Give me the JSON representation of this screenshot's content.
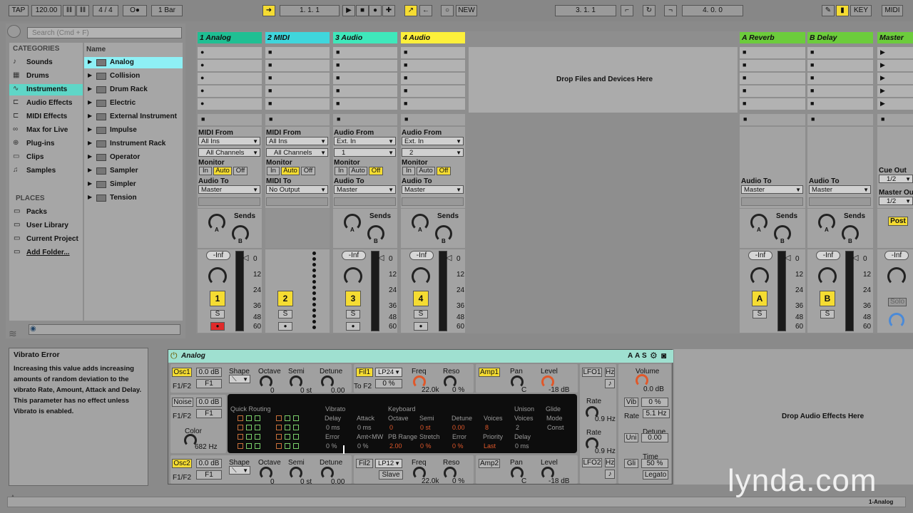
{
  "transport": {
    "tap": "TAP",
    "tempo": "120.00",
    "signature": "4 / 4",
    "metronome": "O●",
    "quantize": "1 Bar",
    "position": "1.  1.  1",
    "new": "NEW",
    "loop_start": "3.  1.  1",
    "loop_length": "4.  0.  0",
    "key": "KEY",
    "midi": "MIDI"
  },
  "colors": {
    "accent": "#f5dc32",
    "selected_category": "#5fd6c7",
    "selected_item": "#8ef0f5",
    "device_title": "#9fe0d0",
    "orange": "#e0582a"
  },
  "browser": {
    "search_placeholder": "Search (Cmd + F)",
    "categories_heading": "CATEGORIES",
    "categories": [
      "Sounds",
      "Drums",
      "Instruments",
      "Audio Effects",
      "MIDI Effects",
      "Max for Live",
      "Plug-ins",
      "Clips",
      "Samples"
    ],
    "selected_category": "Instruments",
    "places_heading": "PLACES",
    "places": [
      "Packs",
      "User Library",
      "Current Project",
      "Add Folder..."
    ],
    "name_header": "Name",
    "items": [
      "Analog",
      "Collision",
      "Drum Rack",
      "Electric",
      "External Instrument",
      "Impulse",
      "Instrument Rack",
      "Operator",
      "Sampler",
      "Simpler",
      "Tension"
    ],
    "selected_item": "Analog"
  },
  "session": {
    "drop_text": "Drop Files and Devices Here",
    "sends_label": "Sends",
    "send_a": "A",
    "send_b": "B",
    "meter_scale": [
      "0",
      "12",
      "24",
      "36",
      "48",
      "60"
    ],
    "tracks": [
      {
        "name": "1 Analog",
        "color": "#1fbf93",
        "from_label": "MIDI From",
        "from": "All Ins",
        "channel": "All Channels",
        "monitor_label": "Monitor",
        "monitor": [
          "In",
          "Auto",
          "Off"
        ],
        "monitor_active": 1,
        "to_label": "Audio To",
        "to": "Master",
        "volume": "-Inf",
        "number": "1",
        "solo": "S"
      },
      {
        "name": "2 MIDI",
        "color": "#3fd6dc",
        "from_label": "MIDI From",
        "from": "All Ins",
        "channel": "All Channels",
        "monitor_label": "Monitor",
        "monitor": [
          "In",
          "Auto",
          "Off"
        ],
        "monitor_active": 1,
        "to_label": "MIDI To",
        "to": "No Output",
        "number": "2",
        "solo": "S"
      },
      {
        "name": "3 Audio",
        "color": "#3fe8bb",
        "from_label": "Audio From",
        "from": "Ext. In",
        "channel": "1",
        "monitor_label": "Monitor",
        "monitor": [
          "In",
          "Auto",
          "Off"
        ],
        "monitor_active": 2,
        "to_label": "Audio To",
        "to": "Master",
        "volume": "-Inf",
        "number": "3",
        "solo": "S"
      },
      {
        "name": "4 Audio",
        "color": "#fdf03a",
        "from_label": "Audio From",
        "from": "Ext. In",
        "channel": "2",
        "monitor_label": "Monitor",
        "monitor": [
          "In",
          "Auto",
          "Off"
        ],
        "monitor_active": 2,
        "to_label": "Audio To",
        "to": "Master",
        "volume": "-Inf",
        "number": "4",
        "solo": "S"
      }
    ],
    "returns": [
      {
        "name": "A Reverb",
        "color": "#6ccc3c",
        "to_label": "Audio To",
        "to": "Master",
        "volume": "-Inf",
        "number": "A",
        "solo": "S"
      },
      {
        "name": "B Delay",
        "color": "#6ccc3c",
        "to_label": "Audio To",
        "to": "Master",
        "volume": "-Inf",
        "number": "B",
        "solo": "S"
      }
    ],
    "master": {
      "name": "Master",
      "color": "#6ccc3c",
      "cue_out_label": "Cue Out",
      "cue_out": "1/2",
      "master_out_label": "Master Out",
      "master_out": "1/2",
      "post": "Post",
      "volume": "-Inf",
      "solo": "Solo"
    }
  },
  "info": {
    "title": "Vibrato Error",
    "body": "Increasing this value adds increasing amounts of random deviation to the vibrato Rate, Amount, Attack and Delay. This parameter has no effect unless Vibrato is enabled."
  },
  "device": {
    "title": "Analog",
    "header_buttons": [
      "A",
      "A",
      "S"
    ],
    "osc1": {
      "label": "Osc1",
      "gain": "0.0 dB",
      "f1f2_label": "F1/F2",
      "f1f2": "F1",
      "shape_label": "Shape",
      "octave_label": "Octave",
      "octave": "0",
      "semi_label": "Semi",
      "semi": "0 st",
      "detune_label": "Detune",
      "detune": "0.00"
    },
    "osc2": {
      "label": "Osc2",
      "gain": "0.0 dB",
      "f1f2_label": "F1/F2",
      "f1f2": "F1",
      "shape_label": "Shape",
      "octave_label": "Octave",
      "octave": "0",
      "semi_label": "Semi",
      "semi": "0 st",
      "detune_label": "Detune",
      "detune": "0.00"
    },
    "noise": {
      "label": "Noise",
      "gain": "0.0 dB",
      "f1f2_label": "F1/F2",
      "f1f2": "F1",
      "color_label": "Color",
      "color": "682 Hz"
    },
    "fil1": {
      "label": "Fil1",
      "type": "LP24",
      "tof2_label": "To F2",
      "tof2": "0 %",
      "freq_label": "Freq",
      "freq": "22.0k",
      "reso_label": "Reso",
      "reso": "0 %"
    },
    "fil2": {
      "label": "Fil2",
      "type": "LP12",
      "slave": "Slave",
      "freq_label": "Freq",
      "freq": "22.0k",
      "reso_label": "Reso",
      "reso": "0 %"
    },
    "amp1": {
      "label": "Amp1",
      "pan_label": "Pan",
      "pan": "C",
      "level_label": "Level",
      "level": "-18 dB"
    },
    "amp2": {
      "label": "Amp2",
      "pan_label": "Pan",
      "pan": "C",
      "level_label": "Level",
      "level": "-18 dB"
    },
    "lfo1": {
      "label": "LFO1",
      "hz": "Hz",
      "rate_label": "Rate",
      "rate": "0.9 Hz"
    },
    "lfo2": {
      "label": "LFO2",
      "hz": "Hz",
      "rate_label": "Rate",
      "rate": "0.9 Hz"
    },
    "global": {
      "volume_label": "Volume",
      "volume": "0.0 dB",
      "vib": "Vib",
      "vib_amount": "0 %",
      "rate_label": "Rate",
      "rate": "5.1 Hz",
      "detune_label": "Detune",
      "uni": "Uni",
      "detune": "0.00",
      "time_label": "Time",
      "gli": "Gli",
      "time": "50 %",
      "legato": "Legato"
    },
    "display": {
      "quick_routing": "Quick Routing",
      "vibrato": "Vibrato",
      "keyboard": "Keyboard",
      "unison": "Unison",
      "glide": "Glide",
      "delay_label": "Delay",
      "delay": "0 ms",
      "error_label": "Error",
      "error": "0 %",
      "attack_label": "Attack",
      "attack": "0 ms",
      "amt_label": "Amt<MW",
      "amt": "0 %",
      "octave_label": "Octave",
      "octave": "0",
      "pb_label": "PB Range",
      "pb": "2.00",
      "semi_label": "Semi",
      "semi": "0 st",
      "stretch_label": "Stretch",
      "stretch": "0 %",
      "detune_label": "Detune",
      "detune": "0.00",
      "kerror_label": "Error",
      "kerror": "0 %",
      "voices_label": "Voices",
      "voices": "8",
      "priority_label": "Priority",
      "priority": "Last",
      "uvoices_label": "Voices",
      "uvoices": "2",
      "udelay_label": "Delay",
      "udelay": "0 ms",
      "mode_label": "Mode",
      "mode": "Const"
    }
  },
  "drop_audio_effects": "Drop Audio Effects Here",
  "status": {
    "track": "1-Analog"
  },
  "watermark": "lynda.com"
}
